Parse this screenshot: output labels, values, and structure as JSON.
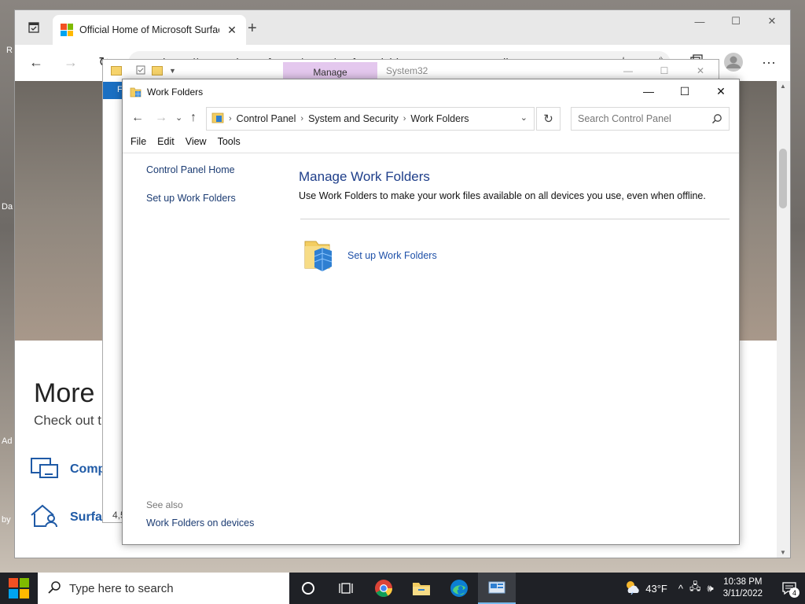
{
  "desktop": {
    "labels": [
      "R",
      "Da",
      "Ad",
      "by"
    ]
  },
  "browser": {
    "tab_title": "Official Home of Microsoft Surface",
    "tab_close": "✕",
    "new_tab": "+",
    "win_minimize": "—",
    "win_maximize": "☐",
    "win_close": "✕",
    "back": "←",
    "forward": "→",
    "refresh": "↻",
    "address": "https://www.microsoft.com/en-us/surface?icid=mscom_marcom_dlc",
    "star": "☆",
    "favorites": "✩",
    "more": "···",
    "more_heading": "More o",
    "more_sub": "Check out t",
    "link_1": "Compa",
    "link_2": "Surfac",
    "scroll_up": "▲",
    "scroll_down": "▼"
  },
  "system32": {
    "manage_tab": "Manage",
    "title": "System32",
    "blue_tab": "F",
    "partial_text": "4,5"
  },
  "work_folders": {
    "window_title": "Work Folders",
    "win_minimize": "—",
    "win_maximize": "☐",
    "win_close": "✕",
    "nav_back": "←",
    "nav_forward": "→",
    "nav_recent": "⌄",
    "nav_up": "↑",
    "breadcrumb": [
      "Control Panel",
      "System and Security",
      "Work Folders"
    ],
    "crumb_dropdown": "⌄",
    "refresh": "↻",
    "search_placeholder": "Search Control Panel",
    "menu": [
      "File",
      "Edit",
      "View",
      "Tools"
    ],
    "left": {
      "home": "Control Panel Home",
      "setup": "Set up Work Folders",
      "see_also": "See also",
      "devices": "Work Folders on devices"
    },
    "main": {
      "heading": "Manage Work Folders",
      "description": "Use Work Folders to make your work files available on all devices you use, even when offline.",
      "task_link": "Set up Work Folders"
    }
  },
  "taskbar": {
    "search_placeholder": "Type here to search",
    "temperature": "43°F",
    "time": "10:38 PM",
    "date": "3/11/2022",
    "notification_count": "4",
    "chevron": "^",
    "network": "🖧",
    "volume": "🕪"
  },
  "colors": {
    "accent": "#1e3e8a",
    "link": "#1c3c73",
    "manage_tab": "#e4c8ee",
    "taskbar": "#1f2126"
  }
}
